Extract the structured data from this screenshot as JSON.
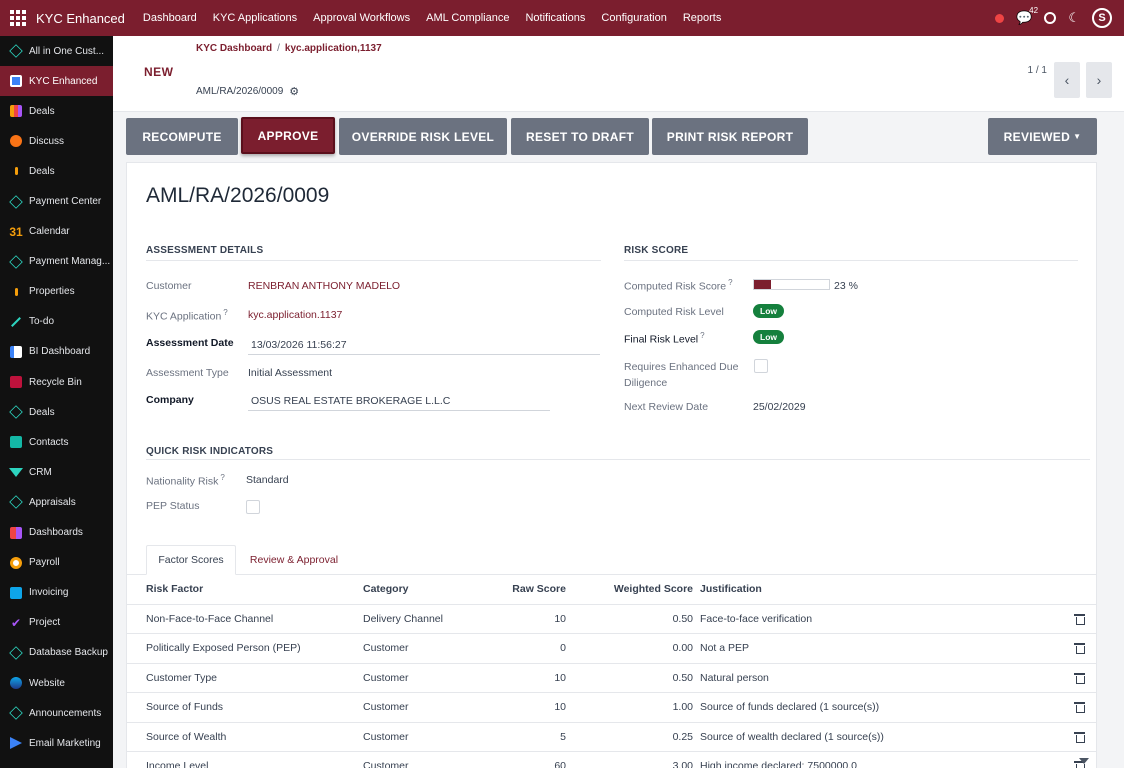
{
  "topbar": {
    "brand": "KYC Enhanced",
    "menu": [
      "Dashboard",
      "KYC Applications",
      "Approval Workflows",
      "AML Compliance",
      "Notifications",
      "Configuration",
      "Reports"
    ],
    "chat_count": "42",
    "avatar_letter": "S"
  },
  "sidebar": {
    "items": [
      {
        "label": "All in One Cust...",
        "icon": "cube-icon"
      },
      {
        "label": "KYC Enhanced",
        "icon": "kyc-icon"
      },
      {
        "label": "Deals",
        "icon": "deals-icon"
      },
      {
        "label": "Discuss",
        "icon": "discuss-icon"
      },
      {
        "label": "Deals",
        "icon": "dot-icon"
      },
      {
        "label": "Payment Center",
        "icon": "cube-icon"
      },
      {
        "label": "Calendar",
        "icon": "calendar-icon"
      },
      {
        "label": "Payment Manag...",
        "icon": "cube-icon"
      },
      {
        "label": "Properties",
        "icon": "dot-icon"
      },
      {
        "label": "To-do",
        "icon": "todo-icon"
      },
      {
        "label": "BI Dashboard",
        "icon": "bi-icon"
      },
      {
        "label": "Recycle Bin",
        "icon": "recycle-icon"
      },
      {
        "label": "Deals",
        "icon": "cube-icon"
      },
      {
        "label": "Contacts",
        "icon": "contacts-icon"
      },
      {
        "label": "CRM",
        "icon": "crm-icon"
      },
      {
        "label": "Appraisals",
        "icon": "cube-icon"
      },
      {
        "label": "Dashboards",
        "icon": "dashboards-icon"
      },
      {
        "label": "Payroll",
        "icon": "payroll-icon"
      },
      {
        "label": "Invoicing",
        "icon": "invoicing-icon"
      },
      {
        "label": "Project",
        "icon": "project-icon"
      },
      {
        "label": "Database Backup",
        "icon": "cube-icon"
      },
      {
        "label": "Website",
        "icon": "website-icon"
      },
      {
        "label": "Announcements",
        "icon": "cube-icon"
      },
      {
        "label": "Email Marketing",
        "icon": "email-icon"
      }
    ]
  },
  "control": {
    "breadcrumb_root": "KYC Dashboard",
    "breadcrumb_sep": "/",
    "breadcrumb_current": "kyc.application,1137",
    "new_label": "NEW",
    "record_name": "AML/RA/2026/0009",
    "pager": "1 / 1"
  },
  "actions": {
    "recompute": "RECOMPUTE",
    "approve": "APPROVE",
    "override": "OVERRIDE RISK LEVEL",
    "reset": "RESET TO DRAFT",
    "print": "PRINT RISK REPORT",
    "status": "REVIEWED"
  },
  "form": {
    "title": "AML/RA/2026/0009",
    "assessment": {
      "section_title": "ASSESSMENT DETAILS",
      "customer_label": "Customer",
      "customer": "RENBRAN ANTHONY MADELO",
      "kyc_label": "KYC Application",
      "kyc": "kyc.application.1137",
      "date_label": "Assessment Date",
      "date": "13/03/2026 11:56:27",
      "type_label": "Assessment Type",
      "type": "Initial Assessment",
      "company_label": "Company",
      "company": "OSUS REAL ESTATE BROKERAGE L.L.C"
    },
    "risk": {
      "section_title": "RISK SCORE",
      "computed_score_label": "Computed Risk Score",
      "computed_score_value": 23,
      "computed_score_text": "23 %",
      "computed_level_label": "Computed Risk Level",
      "computed_level": "Low",
      "final_level_label": "Final Risk Level",
      "final_level": "Low",
      "edd_label_1": "Requires Enhanced Due",
      "edd_label_2": "Diligence",
      "next_review_label": "Next Review Date",
      "next_review": "25/02/2029"
    },
    "quick": {
      "section_title": "QUICK RISK INDICATORS",
      "nationality_label": "Nationality Risk",
      "nationality": "Standard",
      "pep_label": "PEP Status"
    }
  },
  "tabs": {
    "factor_scores": "Factor Scores",
    "review": "Review & Approval"
  },
  "table": {
    "headers": {
      "factor": "Risk Factor",
      "category": "Category",
      "raw": "Raw Score",
      "weighted": "Weighted Score",
      "justification": "Justification"
    },
    "rows": [
      {
        "factor": "Non-Face-to-Face Channel",
        "category": "Delivery Channel",
        "raw": "10",
        "weighted": "0.50",
        "justification": "Face-to-face verification"
      },
      {
        "factor": "Politically Exposed Person (PEP)",
        "category": "Customer",
        "raw": "0",
        "weighted": "0.00",
        "justification": "Not a PEP"
      },
      {
        "factor": "Customer Type",
        "category": "Customer",
        "raw": "10",
        "weighted": "0.50",
        "justification": "Natural person"
      },
      {
        "factor": "Source of Funds",
        "category": "Customer",
        "raw": "10",
        "weighted": "1.00",
        "justification": "Source of funds declared (1 source(s))"
      },
      {
        "factor": "Source of Wealth",
        "category": "Customer",
        "raw": "5",
        "weighted": "0.25",
        "justification": "Source of wealth declared (1 source(s))"
      },
      {
        "factor": "Income Level",
        "category": "Customer",
        "raw": "60",
        "weighted": "3.00",
        "justification": "High income declared: 7500000.0"
      }
    ]
  },
  "colors": {
    "brand": "#7b1e2e",
    "success": "#15803d",
    "button_grey": "#6b7280"
  }
}
